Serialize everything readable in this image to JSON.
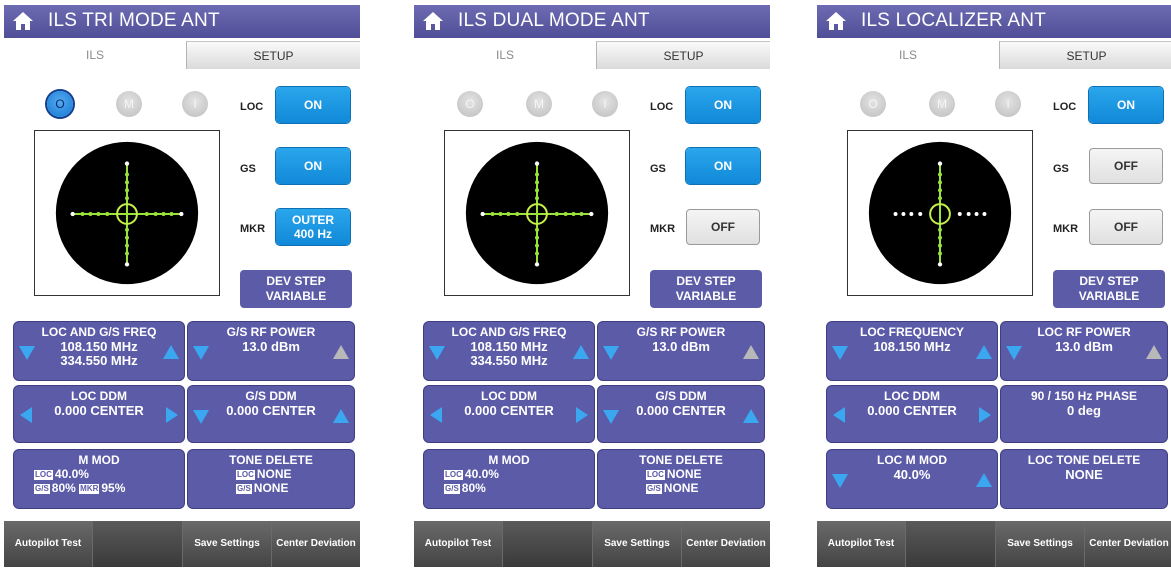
{
  "screens": [
    {
      "title": "ILS TRI MODE  ANT",
      "tabs": {
        "ils": "ILS",
        "setup": "SETUP"
      },
      "markers": {
        "o": "O",
        "m": "M",
        "i": "I",
        "active": "O"
      },
      "loc": {
        "label": "LOC",
        "value": "ON"
      },
      "gs": {
        "label": "GS",
        "value": "ON"
      },
      "mkr": {
        "label": "MKR",
        "value_line1": "OUTER",
        "value_line2": "400 Hz"
      },
      "dev_step": {
        "line1": "DEV STEP",
        "line2": "VARIABLE"
      },
      "panels": {
        "r1c1": {
          "title": "LOC AND G/S FREQ",
          "line1": "108.150 MHz",
          "line2": "334.550 MHz"
        },
        "r1c2": {
          "title": "G/S RF POWER",
          "line1": "13.0 dBm"
        },
        "r2c1": {
          "title": "LOC DDM",
          "line1": "0.000 CENTER"
        },
        "r2c2": {
          "title": "G/S DDM",
          "line1": "0.000 CENTER"
        },
        "r3c1": {
          "title": "M MOD",
          "tag_loc": "LOC",
          "loc_value": "40.0%",
          "tag_gs": "G/S",
          "gs_value": "80%",
          "tag_mkr": "MKR",
          "mkr_value": "95%"
        },
        "r3c2": {
          "title": "TONE DELETE",
          "tag_loc": "LOC",
          "loc_value": "NONE",
          "tag_gs": "G/S",
          "gs_value": "NONE"
        }
      },
      "bottom": {
        "b1": "Autopilot Test",
        "b2": "",
        "b3": "Save Settings",
        "b4": "Center Deviation"
      }
    },
    {
      "title": "ILS DUAL MODE  ANT",
      "tabs": {
        "ils": "ILS",
        "setup": "SETUP"
      },
      "markers": {
        "o": "O",
        "m": "M",
        "i": "I",
        "active": ""
      },
      "loc": {
        "label": "LOC",
        "value": "ON"
      },
      "gs": {
        "label": "GS",
        "value": "ON"
      },
      "mkr": {
        "label": "MKR",
        "value_line1": "OFF",
        "value_line2": ""
      },
      "dev_step": {
        "line1": "DEV STEP",
        "line2": "VARIABLE"
      },
      "panels": {
        "r1c1": {
          "title": "LOC AND G/S FREQ",
          "line1": "108.150 MHz",
          "line2": "334.550 MHz"
        },
        "r1c2": {
          "title": "G/S RF POWER",
          "line1": "13.0 dBm"
        },
        "r2c1": {
          "title": "LOC DDM",
          "line1": "0.000 CENTER"
        },
        "r2c2": {
          "title": "G/S DDM",
          "line1": "0.000 CENTER"
        },
        "r3c1": {
          "title": "M MOD",
          "tag_loc": "LOC",
          "loc_value": "40.0%",
          "tag_gs": "G/S",
          "gs_value": "80%"
        },
        "r3c2": {
          "title": "TONE DELETE",
          "tag_loc": "LOC",
          "loc_value": "NONE",
          "tag_gs": "G/S",
          "gs_value": "NONE"
        }
      },
      "bottom": {
        "b1": "Autopilot Test",
        "b2": "",
        "b3": "Save Settings",
        "b4": "Center Deviation"
      }
    },
    {
      "title": "ILS LOCALIZER  ANT",
      "tabs": {
        "ils": "ILS",
        "setup": "SETUP"
      },
      "markers": {
        "o": "O",
        "m": "M",
        "i": "I",
        "active": ""
      },
      "loc": {
        "label": "LOC",
        "value": "ON"
      },
      "gs": {
        "label": "GS",
        "value": "OFF"
      },
      "mkr": {
        "label": "MKR",
        "value_line1": "OFF",
        "value_line2": ""
      },
      "dev_step": {
        "line1": "DEV STEP",
        "line2": "VARIABLE"
      },
      "panels": {
        "r1c1": {
          "title": "LOC FREQUENCY",
          "line1": "108.150 MHz"
        },
        "r1c2": {
          "title": "LOC RF POWER",
          "line1": "13.0 dBm"
        },
        "r2c1": {
          "title": "LOC DDM",
          "line1": "0.000 CENTER"
        },
        "r2c2": {
          "title": "90 / 150 Hz PHASE",
          "line1": "0 deg"
        },
        "r3c1": {
          "title": "LOC M MOD",
          "line1": "40.0%"
        },
        "r3c2": {
          "title": "LOC TONE DELETE",
          "line1": "NONE"
        }
      },
      "bottom": {
        "b1": "Autopilot Test",
        "b2": "",
        "b3": "Save Settings",
        "b4": "Center Deviation"
      }
    }
  ],
  "icons": {
    "home": "home-icon",
    "arrow_down": "triangle-down-icon",
    "arrow_up": "triangle-up-icon",
    "arrow_left": "triangle-left-icon",
    "arrow_right": "triangle-right-icon"
  },
  "colors": {
    "titlebar": "#5c5ba8",
    "panel": "#5c5ba8",
    "button_on": "#1a93dd",
    "arrow": "#3aa7f0",
    "crosshair": "#9be33a",
    "scope_bg": "#000000"
  }
}
